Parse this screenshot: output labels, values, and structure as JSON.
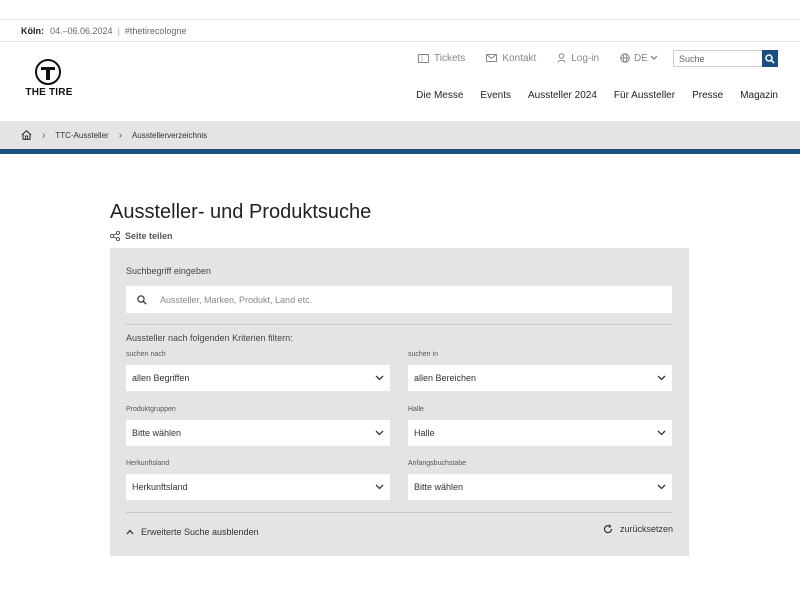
{
  "infobar": {
    "city": "Köln:",
    "dates": "04.–06.06.2024",
    "separator": "|",
    "hashtag": "#thetirecologne"
  },
  "logo": {
    "text": "THE TIRE",
    "icon": "tire-logo-icon"
  },
  "utility_nav": {
    "tickets": "Tickets",
    "kontakt": "Kontakt",
    "login": "Log-in",
    "language": "DE"
  },
  "top_search": {
    "placeholder": "Suche"
  },
  "main_nav": [
    "Die Messe",
    "Events",
    "Aussteller 2024",
    "Für Aussteller",
    "Presse",
    "Magazin"
  ],
  "breadcrumb": {
    "items": [
      "TTC-Aussteller",
      "Ausstellerverzeichnis"
    ]
  },
  "page": {
    "title": "Aussteller- und Produktsuche",
    "share": "Seite teilen"
  },
  "search_panel": {
    "search_label": "Suchbegriff eingeben",
    "search_placeholder": "Aussteller, Marken, Produkt, Land etc.",
    "filter_title": "Aussteller nach folgenden Kriterien filtern:",
    "filters": {
      "suchen_nach": {
        "label": "suchen nach",
        "value": "allen Begriffen"
      },
      "suchen_in": {
        "label": "suchen in",
        "value": "allen Bereichen"
      },
      "produktgruppen": {
        "label": "Produktgruppen",
        "value": "Bitte wählen"
      },
      "halle": {
        "label": "Halle",
        "value": "Halle"
      },
      "herkunftsland": {
        "label": "Herkunftsland",
        "value": "Herkunftsland"
      },
      "anfangsbuchstabe": {
        "label": "Anfangsbuchstabe",
        "value": "Bitte wählen"
      }
    },
    "toggle_label": "Erweiterte Suche ausblenden",
    "reset_label": "zurücksetzen"
  },
  "colors": {
    "brand_blue": "#1b4f82",
    "panel_gray": "#e4e4e4"
  }
}
